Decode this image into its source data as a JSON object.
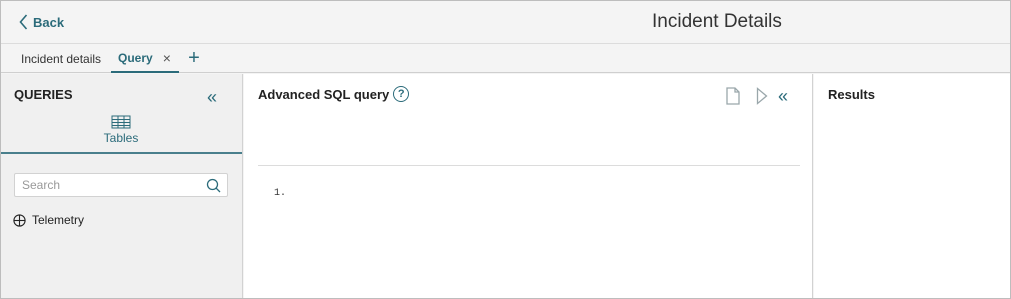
{
  "header": {
    "back_label": "Back",
    "title": "Incident Details"
  },
  "tabs": [
    {
      "label": "Incident details",
      "active": false
    },
    {
      "label": "Query",
      "active": true,
      "close_symbol": "×"
    }
  ],
  "tab_add_symbol": "+",
  "queries_panel": {
    "title": "QUERIES",
    "collapse_symbol": "«",
    "tables_tab_label": "Tables",
    "search_placeholder": "Search",
    "tree_items": [
      {
        "label": "Telemetry",
        "icon": "expand-circle-icon"
      }
    ]
  },
  "sql_panel": {
    "title": "Advanced SQL query",
    "help_symbol": "?",
    "collapse_symbol": "«",
    "editor_lines": [
      "1."
    ]
  },
  "results_panel": {
    "title": "Results"
  },
  "colors": {
    "accent": "#2b6b7a",
    "panel_bg": "#f0f0f0",
    "border": "#d2d2d2"
  }
}
